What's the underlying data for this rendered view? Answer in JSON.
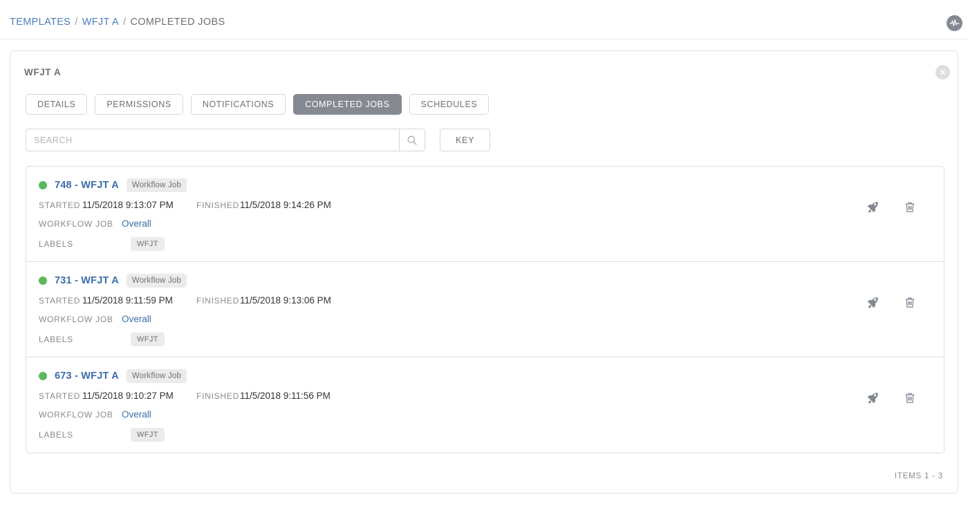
{
  "breadcrumb": {
    "items": [
      {
        "label": "TEMPLATES",
        "link": true
      },
      {
        "label": "WFJT A",
        "link": true
      },
      {
        "label": "COMPLETED JOBS",
        "link": false
      }
    ],
    "separator": "/"
  },
  "header": {
    "activity_icon": "activity-stream-icon"
  },
  "panel": {
    "title": "WFJT A",
    "close_icon": "close-icon"
  },
  "tabs": [
    {
      "label": "DETAILS",
      "active": false
    },
    {
      "label": "PERMISSIONS",
      "active": false
    },
    {
      "label": "NOTIFICATIONS",
      "active": false
    },
    {
      "label": "COMPLETED JOBS",
      "active": true
    },
    {
      "label": "SCHEDULES",
      "active": false
    }
  ],
  "search": {
    "placeholder": "SEARCH",
    "value": "",
    "search_icon": "search-icon",
    "key_label": "KEY"
  },
  "labels": {
    "started": "STARTED",
    "finished": "FINISHED",
    "workflow_job": "WORKFLOW JOB",
    "labels": "LABELS"
  },
  "jobs": [
    {
      "name": "748 - WFJT A",
      "type_badge": "Workflow Job",
      "status": "successful",
      "status_color": "#5cb85c",
      "started": "11/5/2018 9:13:07 PM",
      "finished": "11/5/2018 9:14:26 PM",
      "workflow_job": "Overall",
      "label_chip": "WFJT",
      "relaunch_icon": "rocket-icon",
      "delete_icon": "trash-icon"
    },
    {
      "name": "731 - WFJT A",
      "type_badge": "Workflow Job",
      "status": "successful",
      "status_color": "#5cb85c",
      "started": "11/5/2018 9:11:59 PM",
      "finished": "11/5/2018 9:13:06 PM",
      "workflow_job": "Overall",
      "label_chip": "WFJT",
      "relaunch_icon": "rocket-icon",
      "delete_icon": "trash-icon"
    },
    {
      "name": "673 - WFJT A",
      "type_badge": "Workflow Job",
      "status": "successful",
      "status_color": "#5cb85c",
      "started": "11/5/2018 9:10:27 PM",
      "finished": "11/5/2018 9:11:56 PM",
      "workflow_job": "Overall",
      "label_chip": "WFJT",
      "relaunch_icon": "rocket-icon",
      "delete_icon": "trash-icon"
    }
  ],
  "footer": {
    "items_count": "ITEMS  1 - 3"
  },
  "colors": {
    "link": "#3a6ea8",
    "breadcrumb_link": "#4a7ebb",
    "muted": "#8a8a8a",
    "active_tab_bg": "#848992",
    "success": "#5cb85c",
    "border": "#dedede"
  }
}
